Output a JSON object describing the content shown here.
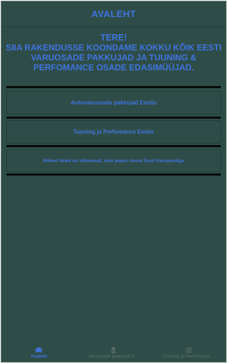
{
  "header": {
    "title": "AVALEHT"
  },
  "intro": {
    "greeting": "TERE!",
    "text": "SIIA RAKENDUSSE KOONDAME KOKKU KÕIK EESTI VARUOSADE PAKKUJAD JA TUUNING & PERFOMANCE OSADE EDASIMÜÜJAD."
  },
  "cards": [
    {
      "label": "Autovaruosade pakkujad Eestis"
    },
    {
      "label": "Tuuning ja Perfomance Eestis"
    },
    {
      "label": "Mõned lehed ka välismaalt, kuid peaks olema Eesti transpordiga"
    }
  ],
  "bottom_nav": {
    "items": [
      {
        "label": "Avaleht",
        "icon": "car-icon",
        "active": true
      },
      {
        "label": "Varuosade pakkujad E...",
        "icon": "document-icon",
        "active": false
      },
      {
        "label": "Tuuning & Perfomance...",
        "icon": "list-icon",
        "active": false
      }
    ]
  },
  "colors": {
    "background": "#2f4d48",
    "accent": "#3f74e0",
    "separator": "#0a0a0a",
    "inactive": "#5d6f6b"
  }
}
